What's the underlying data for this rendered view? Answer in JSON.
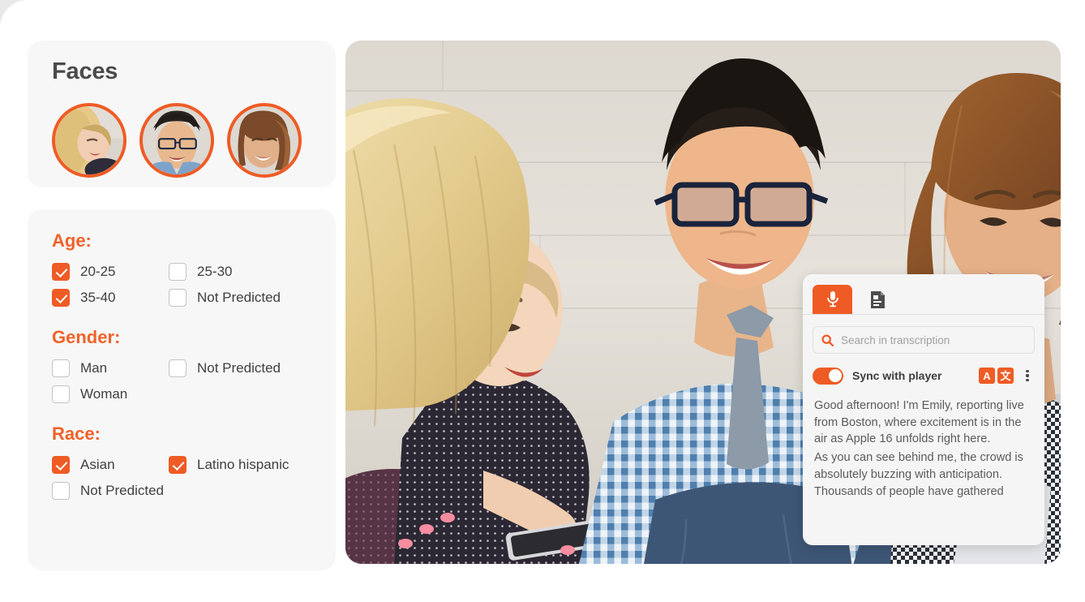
{
  "theme": {
    "accent": "#ef5b25",
    "accent_title": "#f0622a",
    "card_bg": "#f7f7f7",
    "page_bg": "#ffffff",
    "backdrop": "#e9e9ea",
    "text_dark": "#3f3f3f",
    "text_muted": "#5b5b5b",
    "placeholder": "#a0a0a0"
  },
  "faces_card": {
    "title": "Faces",
    "avatars": [
      {
        "name": "face-thumbnail-1",
        "alt": "blonde woman smiling"
      },
      {
        "name": "face-thumbnail-2",
        "alt": "man with glasses smiling"
      },
      {
        "name": "face-thumbnail-3",
        "alt": "woman with brown hair smiling"
      }
    ]
  },
  "filters": {
    "groups": [
      {
        "title": "Age:",
        "options": [
          {
            "label": "20-25",
            "checked": true
          },
          {
            "label": "25-30",
            "checked": false
          },
          {
            "label": "35-40",
            "checked": true
          },
          {
            "label": "Not Predicted",
            "checked": false
          }
        ]
      },
      {
        "title": "Gender:",
        "options": [
          {
            "label": "Man",
            "checked": false
          },
          {
            "label": "Not Predicted",
            "checked": false
          },
          {
            "label": "Woman",
            "checked": false
          }
        ]
      },
      {
        "title": "Race:",
        "options": [
          {
            "label": "Asian",
            "checked": true
          },
          {
            "label": "Latino hispanic",
            "checked": true
          },
          {
            "label": "Not Predicted",
            "checked": false
          }
        ]
      }
    ]
  },
  "photo": {
    "alt": "Three young people sitting outdoors against a white wall, a woman with long blonde hair holding a tablet, a man in a blue checkered shirt and tie using a silver laptop, and a woman in a houndstooth jacket"
  },
  "transcription": {
    "tabs": [
      {
        "icon": "microphone-icon",
        "label": "",
        "active": true
      },
      {
        "icon": "document-subtitle-icon",
        "label": "",
        "active": false
      }
    ],
    "search": {
      "placeholder": "Search in transcription",
      "value": "",
      "icon": "search-icon"
    },
    "sync": {
      "label": "Sync with player",
      "enabled": true
    },
    "language_badges": [
      {
        "name": "source-language-badge",
        "glyph": "A"
      },
      {
        "name": "translate-language-badge",
        "glyph": "文"
      }
    ],
    "menu_icon": "kebab-menu-icon",
    "paragraphs": [
      "Good afternoon! I'm Emily, reporting live from Boston, where excitement is in the air as Apple 16 unfolds right here.",
      "As you can see behind me, the crowd is absolutely buzzing with anticipation. Thousands of people have gathered"
    ]
  }
}
